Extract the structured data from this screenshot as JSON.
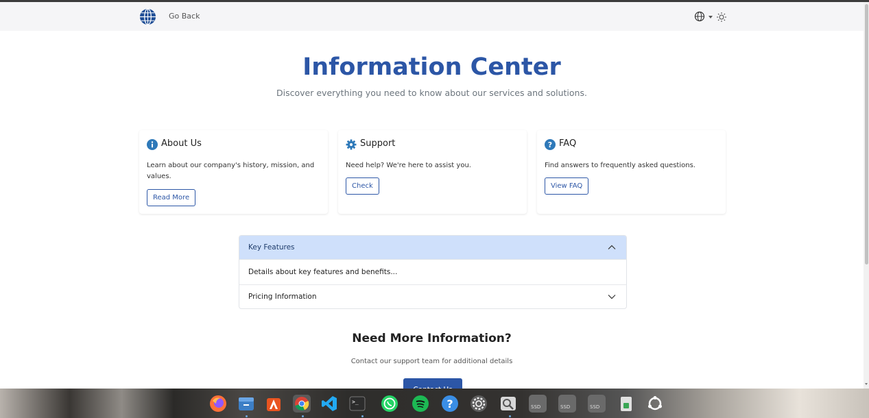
{
  "nav": {
    "back_label": "Go Back"
  },
  "hero": {
    "title": "Information Center",
    "subtitle": "Discover everything you need to know about our services and solutions."
  },
  "cards": [
    {
      "title": "About Us",
      "text": "Learn about our company's history, mission, and values.",
      "button": "Read More",
      "icon": "info-circle-icon"
    },
    {
      "title": "Support",
      "text": "Need help? We're here to assist you.",
      "button": "Check",
      "icon": "gear-icon"
    },
    {
      "title": "FAQ",
      "text": "Find answers to frequently asked questions.",
      "button": "View FAQ",
      "icon": "question-circle-icon"
    }
  ],
  "accordion": {
    "items": [
      {
        "title": "Key Features",
        "body": "Details about key features and benefits...",
        "expanded": true
      },
      {
        "title": "Pricing Information",
        "expanded": false
      }
    ]
  },
  "more": {
    "title": "Need More Information?",
    "subtitle": "Contact our support team for additional details",
    "button": "Contact Us"
  },
  "taskbar": {
    "apps": [
      "firefox",
      "files",
      "app-center",
      "chrome",
      "vscode",
      "terminal",
      "whatsapp",
      "spotify",
      "help",
      "settings",
      "image-viewer",
      "ssd-drive-1",
      "ssd-drive-2",
      "ssd-drive-3",
      "trash",
      "ubuntu-apps"
    ],
    "ssd_label": "SSD"
  },
  "colors": {
    "primary": "#2c56a6",
    "accordion_active": "#cfe0fb"
  }
}
